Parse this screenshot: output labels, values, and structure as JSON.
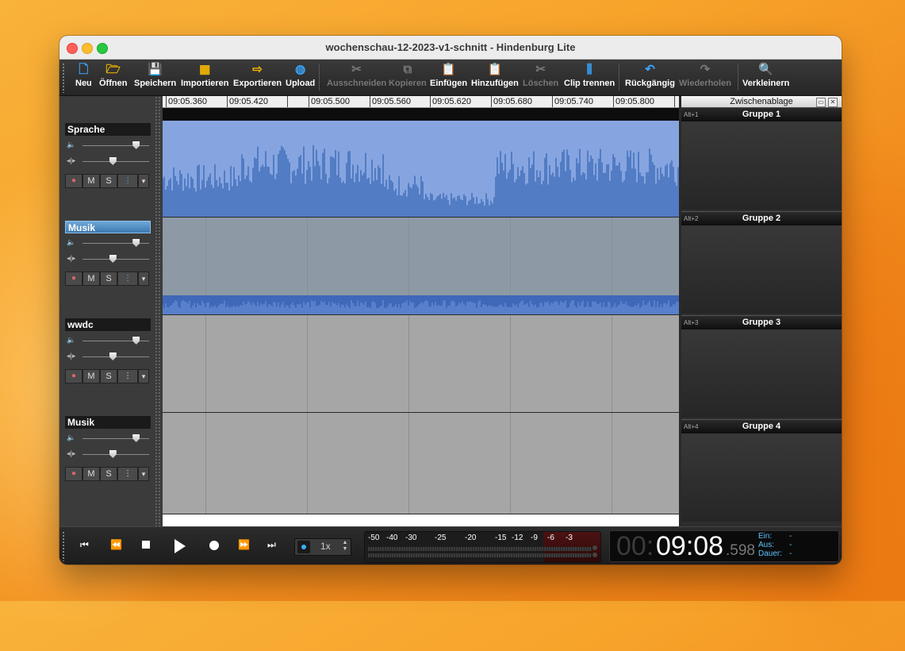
{
  "window": {
    "title": "wochenschau-12-2023-v1-schnitt - Hindenburg Lite"
  },
  "toolbar": {
    "items": [
      {
        "label": "Neu",
        "icon": "new-file-icon",
        "glyph": "🗋",
        "enabled": true,
        "color": "#3aa6ff"
      },
      {
        "label": "Öffnen",
        "icon": "folder-open-icon",
        "glyph": "🗁",
        "enabled": true,
        "color": "#f5b800"
      },
      {
        "label": "Speichern",
        "icon": "save-icon",
        "glyph": "💾",
        "enabled": true,
        "color": "#3aa6ff"
      },
      {
        "label": "Importieren",
        "icon": "import-icon",
        "glyph": "▦",
        "enabled": true,
        "color": "#f5b800"
      },
      {
        "label": "Exportieren",
        "icon": "export-icon",
        "glyph": "⇨",
        "enabled": true,
        "color": "#f5b800"
      },
      {
        "label": "Upload",
        "icon": "globe-icon",
        "glyph": "◍",
        "enabled": true,
        "color": "#3aa6ff"
      },
      {
        "label": "Ausschneiden",
        "icon": "scissors-icon",
        "glyph": "✂",
        "enabled": false,
        "color": "#777777"
      },
      {
        "label": "Kopieren",
        "icon": "copy-icon",
        "glyph": "⧉",
        "enabled": false,
        "color": "#777777"
      },
      {
        "label": "Einfügen",
        "icon": "paste-icon",
        "glyph": "📋",
        "enabled": true,
        "color": "#f5b800"
      },
      {
        "label": "Hinzufügen",
        "icon": "paste-add-icon",
        "glyph": "📋",
        "enabled": true,
        "color": "#f5b800"
      },
      {
        "label": "Löschen",
        "icon": "delete-icon",
        "glyph": "✂",
        "enabled": false,
        "color": "#777777"
      },
      {
        "label": "Clip trennen",
        "icon": "split-clip-icon",
        "glyph": "⫼",
        "enabled": true,
        "color": "#3aa6ff"
      },
      {
        "label": "Rückgängig",
        "icon": "undo-icon",
        "glyph": "↶",
        "enabled": true,
        "color": "#3aa6ff"
      },
      {
        "label": "Wiederholen",
        "icon": "redo-icon",
        "glyph": "↷",
        "enabled": false,
        "color": "#777777"
      },
      {
        "label": "Verkleinern",
        "icon": "zoom-out-icon",
        "glyph": "🔍",
        "enabled": true,
        "color": "#f5b800"
      }
    ]
  },
  "ruler": {
    "ticks": [
      "09:05.360",
      "09:05.420",
      "09:05.500",
      "09:05.560",
      "09:05.620",
      "09:05.680",
      "09:05.740",
      "09:05.800"
    ]
  },
  "tracks": [
    {
      "name": "Sprache",
      "selected": false,
      "volume_level": 0.8,
      "pan_level": 0.45,
      "buttons": {
        "rec": "●",
        "mute": "M",
        "solo": "S",
        "mixer": "⫶",
        "menu": "▾"
      }
    },
    {
      "name": "Musik",
      "selected": true,
      "volume_level": 0.8,
      "pan_level": 0.45,
      "buttons": {
        "rec": "●",
        "mute": "M",
        "solo": "S",
        "mixer": "⫶",
        "menu": "▾"
      }
    },
    {
      "name": "wwdc",
      "selected": false,
      "volume_level": 0.8,
      "pan_level": 0.45,
      "buttons": {
        "rec": "●",
        "mute": "M",
        "solo": "S",
        "mixer": "⫶",
        "menu": "▾"
      }
    },
    {
      "name": "Musik",
      "selected": false,
      "volume_level": 0.8,
      "pan_level": 0.45,
      "buttons": {
        "rec": "●",
        "mute": "M",
        "solo": "S",
        "mixer": "⫶",
        "menu": "▾"
      }
    }
  ],
  "clipboard": {
    "title": "Zwischenablage",
    "groups": [
      {
        "shortcut": "Alt+1",
        "name": "Gruppe 1"
      },
      {
        "shortcut": "Alt+2",
        "name": "Gruppe 2"
      },
      {
        "shortcut": "Alt+3",
        "name": "Gruppe 3"
      },
      {
        "shortcut": "Alt+4",
        "name": "Gruppe 4"
      }
    ]
  },
  "transport": {
    "speed": "1x",
    "meter_labels": [
      "-50",
      "-40",
      "-30",
      "-25",
      "-20",
      "-15",
      "-12",
      "-9",
      "-6",
      "-3"
    ],
    "time_hours": "00:",
    "time_main": "09:08",
    "time_fraction": ".598",
    "in_label": "Ein:",
    "in_value": "-",
    "out_label": "Aus:",
    "out_value": "-",
    "duration_label": "Dauer:",
    "duration_value": "-"
  },
  "colors": {
    "accent": "#3aa6ff",
    "waveform": "#2f62b0",
    "waveform_bg": "#86a5e0"
  }
}
